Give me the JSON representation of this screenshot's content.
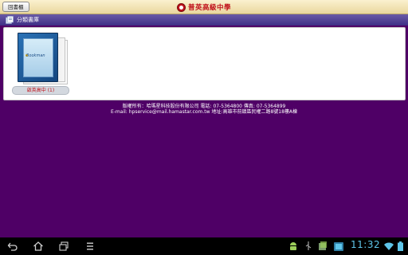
{
  "topbar": {
    "back_label": "回書櫃",
    "school_name": "普英高級中學"
  },
  "category": {
    "title": "分類書庫"
  },
  "books": [
    {
      "label": "啟英高中 (1)",
      "cover_brand": "Bookman"
    }
  ],
  "footer": {
    "line1": "版權所有：哈瑪星科技股份有限公司  電話: 07-5364800  傳真: 07-5364899",
    "line2": "E-mail: hpservice@mail.hamastar.com.tw 地址:高雄市前鎮區民權二路8號18樓A棟"
  },
  "system": {
    "time": "11:32"
  },
  "icons": {
    "nav": [
      "back-icon",
      "home-icon",
      "recent-apps-icon",
      "menu-icon"
    ],
    "status": [
      "android-debug-icon",
      "usb-icon",
      "screenshot-icon",
      "app-notification-icon",
      "wifi-icon",
      "battery-icon"
    ]
  },
  "colors": {
    "background": "#4f0066",
    "topbar": "#f4e5b4",
    "category_bar": "#4a3c8f",
    "accent_red": "#c0111a",
    "clock": "#5fc6ea"
  }
}
